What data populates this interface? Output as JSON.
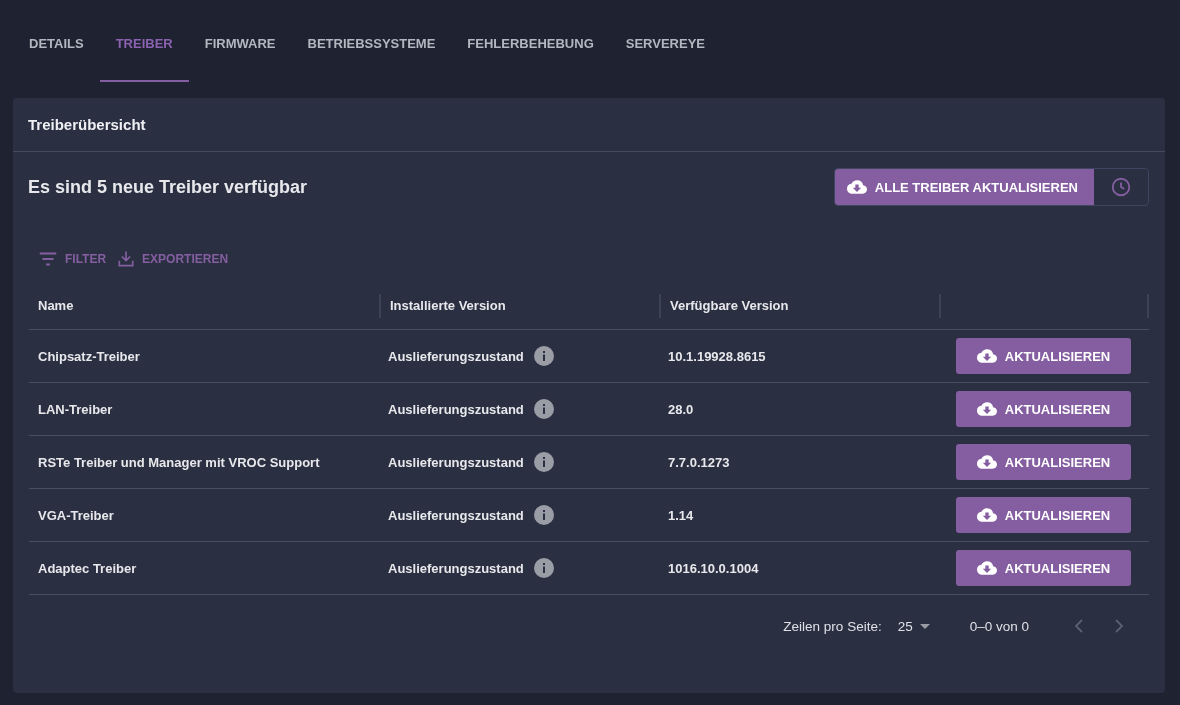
{
  "tabs": [
    {
      "label": "DETAILS",
      "selected": false
    },
    {
      "label": "TREIBER",
      "selected": true
    },
    {
      "label": "FIRMWARE",
      "selected": false
    },
    {
      "label": "BETRIEBSSYSTEME",
      "selected": false
    },
    {
      "label": "FEHLERBEHEBUNG",
      "selected": false
    },
    {
      "label": "SERVEREYE",
      "selected": false
    }
  ],
  "card": {
    "title": "Treiberübersicht",
    "headline": "Es sind 5 neue Treiber verfügbar",
    "update_all_button": "ALLE TREIBER AKTUALISIEREN"
  },
  "toolbar": {
    "filter": "FILTER",
    "export": "EXPORTIEREN"
  },
  "table": {
    "columns": [
      "Name",
      "Installierte Version",
      "Verfügbare Version"
    ],
    "rows": [
      {
        "name": "Chipsatz-Treiber",
        "installed": "Auslieferungszustand",
        "available": "10.1.19928.8615",
        "action": "AKTUALISIEREN"
      },
      {
        "name": "LAN-Treiber",
        "installed": "Auslieferungszustand",
        "available": "28.0",
        "action": "AKTUALISIEREN"
      },
      {
        "name": "RSTe Treiber und Manager mit VROC Support",
        "installed": "Auslieferungszustand",
        "available": "7.7.0.1273",
        "action": "AKTUALISIEREN"
      },
      {
        "name": "VGA-Treiber",
        "installed": "Auslieferungszustand",
        "available": "1.14",
        "action": "AKTUALISIEREN"
      },
      {
        "name": "Adaptec Treiber",
        "installed": "Auslieferungszustand",
        "available": "1016.10.0.1004",
        "action": "AKTUALISIEREN"
      }
    ]
  },
  "pagination": {
    "rows_per_page_label": "Zeilen pro Seite:",
    "rows_per_page": "25",
    "range": "0–0 von 0",
    "prev_disabled": true,
    "next_disabled": true
  }
}
